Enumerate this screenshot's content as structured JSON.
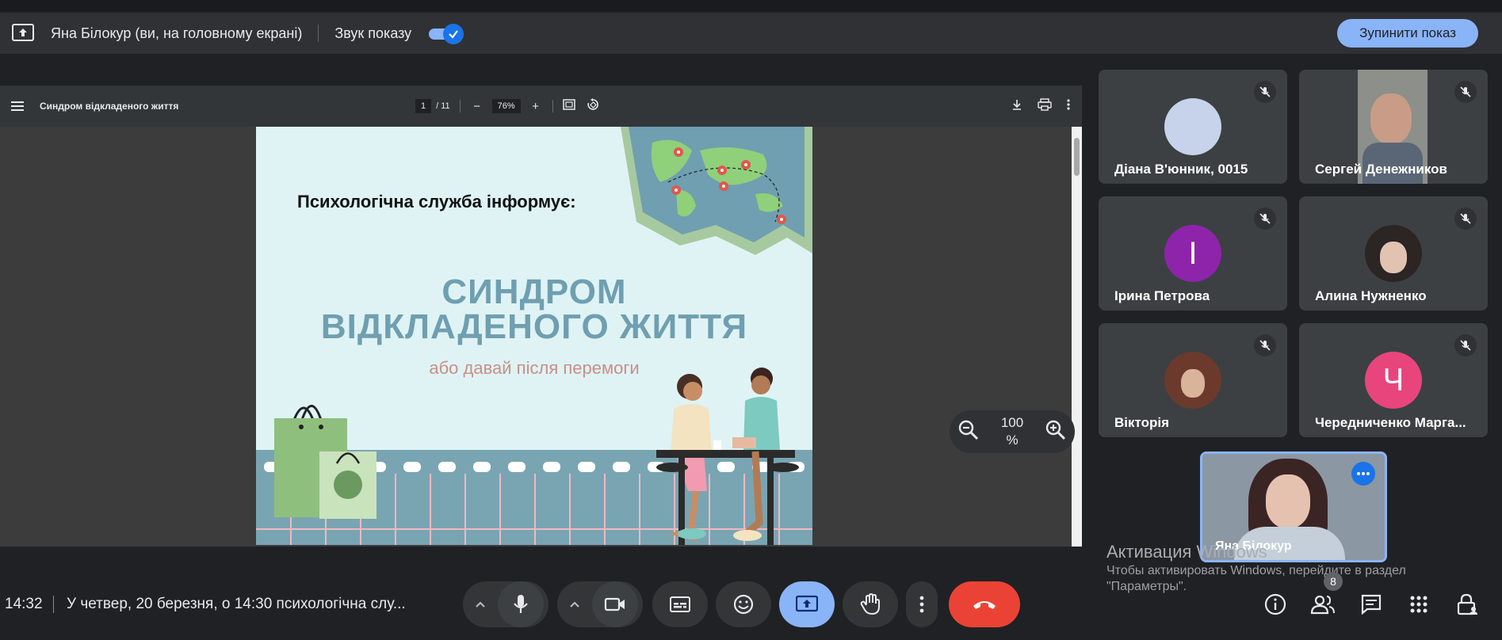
{
  "presenting_bar": {
    "presenter_text": "Яна Білокур (ви, на головному екрані)",
    "sound_label": "Звук показу",
    "sound_enabled": true,
    "stop_button": "Зупинити показ"
  },
  "pdf_viewer": {
    "title": "Синдром відкладеного життя",
    "current_page": "1",
    "total_pages": "/ 11",
    "zoom": "76%",
    "zoom_minus": "−",
    "zoom_plus": "+"
  },
  "slide": {
    "heading": "Психологічна служба інформує:",
    "title_line1": "СИНДРОМ",
    "title_line2": "ВІДКЛАДЕНОГО ЖИТТЯ",
    "subtitle": "або давай після перемоги"
  },
  "zoom_control": {
    "value_line1": "100",
    "value_line2": "%"
  },
  "participants": [
    {
      "name": "Діана В'юнник, 0015",
      "avatar": "",
      "avatar_color": "#c7d3ea"
    },
    {
      "name": "Сергей Денежников",
      "avatar": "",
      "avatar_color": ""
    },
    {
      "name": "Ірина Петрова",
      "avatar": "І",
      "avatar_color": "#8e24aa"
    },
    {
      "name": "Алина Нужненко",
      "avatar": "",
      "avatar_color": ""
    },
    {
      "name": "Вікторія",
      "avatar": "",
      "avatar_color": ""
    },
    {
      "name": "Чередниченко Марга...",
      "avatar": "Ч",
      "avatar_color": "#e8457c"
    }
  ],
  "self_view": {
    "name": "Яна Білокур"
  },
  "activation": {
    "line1": "Активация Windows",
    "line2": "Чтобы активировать Windows, перейдите в раздел",
    "line3": "\"Параметры\"."
  },
  "bottom_bar": {
    "time": "14:32",
    "meeting_title": "У четвер, 20 березня, о 14:30 психологічна слу...",
    "people_count": "8"
  },
  "colors": {
    "accent": "#8ab4f8",
    "end_call": "#ea4335",
    "present_active": "#8ab4f8",
    "background": "#202124"
  }
}
